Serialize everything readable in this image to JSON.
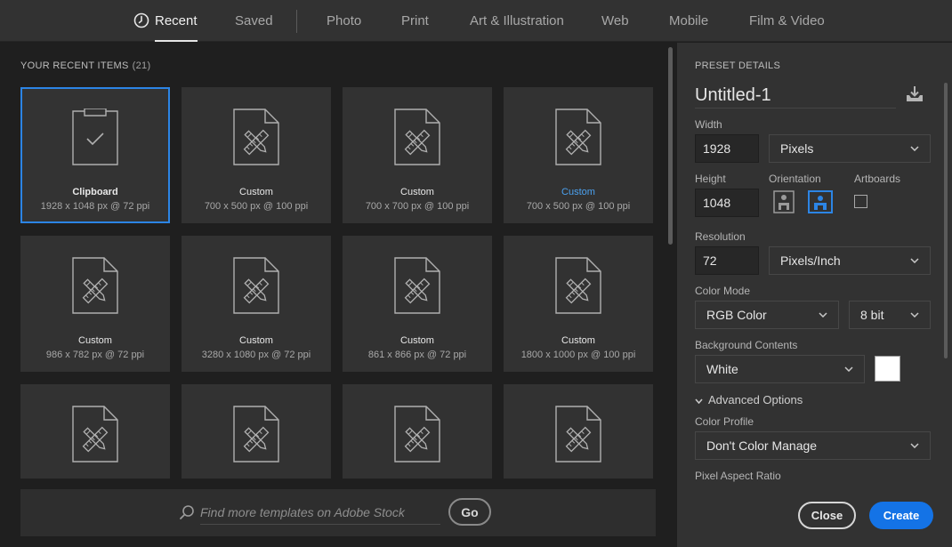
{
  "tabs": [
    {
      "label": "Recent",
      "active": true
    },
    {
      "label": "Saved"
    },
    {
      "label": "Photo"
    },
    {
      "label": "Print"
    },
    {
      "label": "Art & Illustration"
    },
    {
      "label": "Web"
    },
    {
      "label": "Mobile"
    },
    {
      "label": "Film & Video"
    }
  ],
  "recent": {
    "title": "YOUR RECENT ITEMS",
    "count": "(21)",
    "items": [
      {
        "name": "Clipboard",
        "dims": "1928 x 1048 px @ 72 ppi",
        "selected": true,
        "icon": "clipboard-check-icon"
      },
      {
        "name": "Custom",
        "dims": "700 x 500 px @ 100 ppi",
        "icon": "document-ruler-pencil-icon"
      },
      {
        "name": "Custom",
        "dims": "700 x 700 px @ 100 ppi",
        "icon": "document-ruler-pencil-icon"
      },
      {
        "name": "Custom",
        "dims": "700 x 500 px @ 100 ppi",
        "icon": "document-ruler-pencil-icon",
        "highlighted": true
      },
      {
        "name": "Custom",
        "dims": "986 x 782 px @ 72 ppi",
        "icon": "document-ruler-pencil-icon"
      },
      {
        "name": "Custom",
        "dims": "3280 x 1080 px @ 72 ppi",
        "icon": "document-ruler-pencil-icon"
      },
      {
        "name": "Custom",
        "dims": "861 x 866 px @ 72 ppi",
        "icon": "document-ruler-pencil-icon"
      },
      {
        "name": "Custom",
        "dims": "1800 x 1000 px @ 100 ppi",
        "icon": "document-ruler-pencil-icon"
      },
      {
        "name": "",
        "dims": "",
        "icon": "document-ruler-pencil-icon"
      },
      {
        "name": "",
        "dims": "",
        "icon": "document-ruler-pencil-icon"
      },
      {
        "name": "",
        "dims": "",
        "icon": "document-ruler-pencil-icon"
      },
      {
        "name": "",
        "dims": "",
        "icon": "document-ruler-pencil-icon"
      }
    ]
  },
  "search": {
    "placeholder": "Find more templates on Adobe Stock",
    "go_label": "Go"
  },
  "preset": {
    "title": "PRESET DETAILS",
    "doc_name": "Untitled-1",
    "width_label": "Width",
    "width_value": "1928",
    "width_unit": "Pixels",
    "height_label": "Height",
    "height_value": "1048",
    "orientation_label": "Orientation",
    "artboards_label": "Artboards",
    "resolution_label": "Resolution",
    "resolution_value": "72",
    "resolution_unit": "Pixels/Inch",
    "color_mode_label": "Color Mode",
    "color_mode_value": "RGB Color",
    "bit_depth_value": "8 bit",
    "background_label": "Background Contents",
    "background_value": "White",
    "background_color": "#ffffff",
    "advanced_label": "Advanced Options",
    "color_profile_label": "Color Profile",
    "color_profile_value": "Don't Color Manage",
    "pixel_aspect_label": "Pixel Aspect Ratio"
  },
  "actions": {
    "close_label": "Close",
    "create_label": "Create"
  },
  "colors": {
    "accent": "#1473e6",
    "selection": "#2c85e5",
    "link": "#4ba1ef"
  }
}
